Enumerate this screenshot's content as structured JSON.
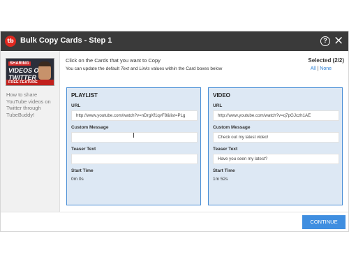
{
  "window": {
    "title": "Bulk Copy Cards - Step 1",
    "logo_text": "tb",
    "help_symbol": "?",
    "close_symbol": "×",
    "icons": {
      "logo": "tubebuddy-logo-icon",
      "help": "help-icon",
      "close": "close-icon"
    }
  },
  "sidebar": {
    "thumbnail": {
      "line1": "SHARING",
      "line2": "VIDEOS ON",
      "line3": "TWITTER",
      "badge": "FREE FEATURE"
    },
    "video_title": "How to share YouTube videos on Twitter through TubeBuddy!"
  },
  "instructions": {
    "line1": "Click on the Cards that you want to Copy",
    "line2_prefix": "You can update the default ",
    "line2_text_word": "Text",
    "line2_middle": " and ",
    "line2_links_word": "Links",
    "line2_suffix": " values within the Card boxes below"
  },
  "selection": {
    "label": "Selected (2/2)",
    "all": "All",
    "separator": "|",
    "none": "None"
  },
  "cards": [
    {
      "type": "PLAYLIST",
      "url_label": "URL",
      "url_value": "http://www.youtube.com/watch?v=nDrgXf1qvF8&list=PLg",
      "message_label": "Custom Message",
      "message_value": "",
      "teaser_label": "Teaser Text",
      "teaser_value": "",
      "start_label": "Start Time",
      "start_value": "0m 0s"
    },
    {
      "type": "VIDEO",
      "url_label": "URL",
      "url_value": "http://www.youtube.com/watch?v=q7pGJczh1AE",
      "message_label": "Custom Message",
      "message_value": "Check out my latest video!",
      "teaser_label": "Teaser Text",
      "teaser_value": "Have you seen my latest?",
      "start_label": "Start Time",
      "start_value": "1m 52s"
    }
  ],
  "footer": {
    "continue_label": "CONTINUE"
  },
  "colors": {
    "titlebar": "#3a3a3a",
    "card_bg": "#dde8f4",
    "card_border": "#4a8fd6",
    "primary_button": "#3f8ee0",
    "link": "#2b7fd4",
    "logo": "#e0281f"
  }
}
